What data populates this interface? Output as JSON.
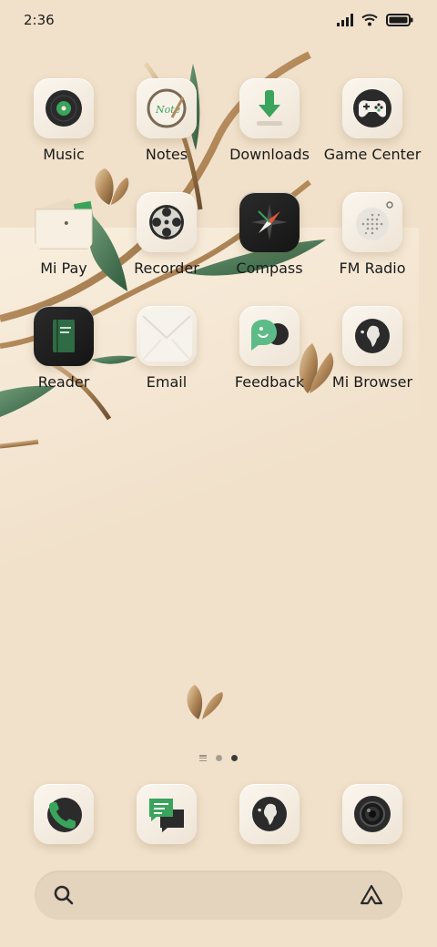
{
  "status_bar": {
    "time": "2:36",
    "icons": [
      "signal-icon",
      "wifi-icon",
      "battery-icon"
    ]
  },
  "apps": [
    {
      "label": "Music",
      "icon": "music-icon"
    },
    {
      "label": "Notes",
      "icon": "notes-icon"
    },
    {
      "label": "Downloads",
      "icon": "downloads-icon"
    },
    {
      "label": "Game Center",
      "icon": "game-controller-icon"
    },
    {
      "label": "Mi Pay",
      "icon": "wallet-icon"
    },
    {
      "label": "Recorder",
      "icon": "film-reel-icon"
    },
    {
      "label": "Compass",
      "icon": "compass-icon"
    },
    {
      "label": "FM Radio",
      "icon": "radio-icon"
    },
    {
      "label": "Reader",
      "icon": "book-icon"
    },
    {
      "label": "Email",
      "icon": "envelope-icon"
    },
    {
      "label": "Feedback",
      "icon": "feedback-icon"
    },
    {
      "label": "Mi Browser",
      "icon": "globe-icon"
    }
  ],
  "notes_icon_text": "Note",
  "page_indicator": {
    "pages": 2,
    "active_page": 2
  },
  "dock": [
    {
      "icon": "phone-icon"
    },
    {
      "icon": "messages-icon"
    },
    {
      "icon": "browser-globe-icon"
    },
    {
      "icon": "camera-icon"
    }
  ],
  "search_bar": {
    "left_icon": "search-icon",
    "right_icon": "assistant-icon"
  },
  "colors": {
    "background": "#f1e1cb",
    "accent_green": "#3aa35c",
    "search_bar": "#e4d3bd"
  }
}
